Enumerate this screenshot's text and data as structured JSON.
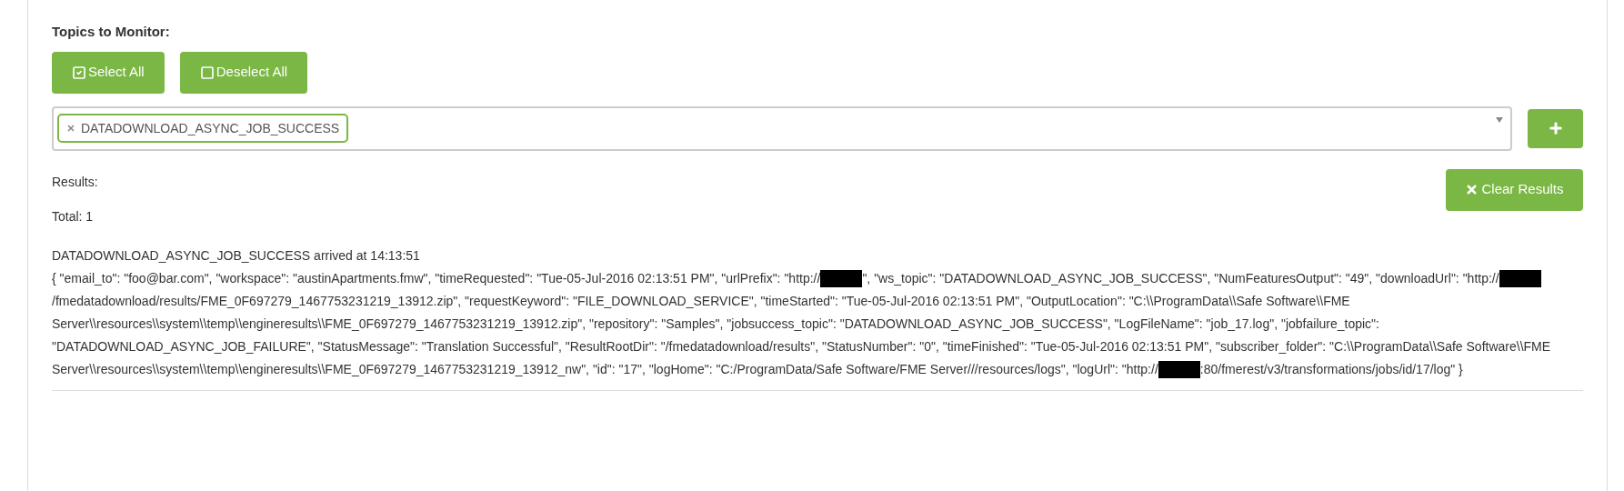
{
  "topics_label": "Topics to Monitor:",
  "buttons": [
    {
      "kind": "select",
      "label": "Select All"
    },
    {
      "kind": "deselect",
      "label": "Deselect All"
    }
  ],
  "topic_select": {
    "tags": [
      {
        "label": "DATADOWNLOAD_ASYNC_JOB_SUCCESS"
      }
    ]
  },
  "results_label": "Results:",
  "clear_button": "Clear Results",
  "total": "Total: 1",
  "message": {
    "heading": "DATADOWNLOAD_ASYNC_JOB_SUCCESS arrived at 14:13:51",
    "parts": [
      {
        "kind": "text",
        "text": "{ \"email_to\": \"foo@bar.com\", \"workspace\": \"austinApartments.fmw\", \"timeRequested\": \"Tue-05-Jul-2016 02:13:51 PM\", \"urlPrefix\": \"http://"
      },
      {
        "kind": "redacted"
      },
      {
        "kind": "text",
        "text": "\", \"ws_topic\": \"DATADOWNLOAD_ASYNC_JOB_SUCCESS\", \"NumFeaturesOutput\": \"49\", \"downloadUrl\": \"http://"
      },
      {
        "kind": "redacted"
      },
      {
        "kind": "text",
        "text": "/fmedatadownload/results/FME_0F697279_1467753231219_13912.zip\", \"requestKeyword\": \"FILE_DOWNLOAD_SERVICE\", \"timeStarted\": \"Tue-05-Jul-2016 02:13:51 PM\", \"OutputLocation\": \"C:\\\\ProgramData\\\\Safe Software\\\\FME Server\\\\resources\\\\system\\\\temp\\\\engineresults\\\\FME_0F697279_1467753231219_13912.zip\", \"repository\": \"Samples\", \"jobsuccess_topic\": \"DATADOWNLOAD_ASYNC_JOB_SUCCESS\", \"LogFileName\": \"job_17.log\", \"jobfailure_topic\": \"DATADOWNLOAD_ASYNC_JOB_FAILURE\", \"StatusMessage\": \"Translation Successful\", \"ResultRootDir\": \"/fmedatadownload/results\", \"StatusNumber\": \"0\", \"timeFinished\": \"Tue-05-Jul-2016 02:13:51 PM\", \"subscriber_folder\": \"C:\\\\ProgramData\\\\Safe Software\\\\FME Server\\\\resources\\\\system\\\\temp\\\\engineresults\\\\FME_0F697279_1467753231219_13912_nw\", \"id\": \"17\", \"logHome\": \"C:/ProgramData/Safe Software/FME Server///resources/logs\", \"logUrl\": \"http://"
      },
      {
        "kind": "redacted"
      },
      {
        "kind": "text",
        "text": ":80/fmerest/v3/transformations/jobs/id/17/log\" }"
      }
    ]
  }
}
